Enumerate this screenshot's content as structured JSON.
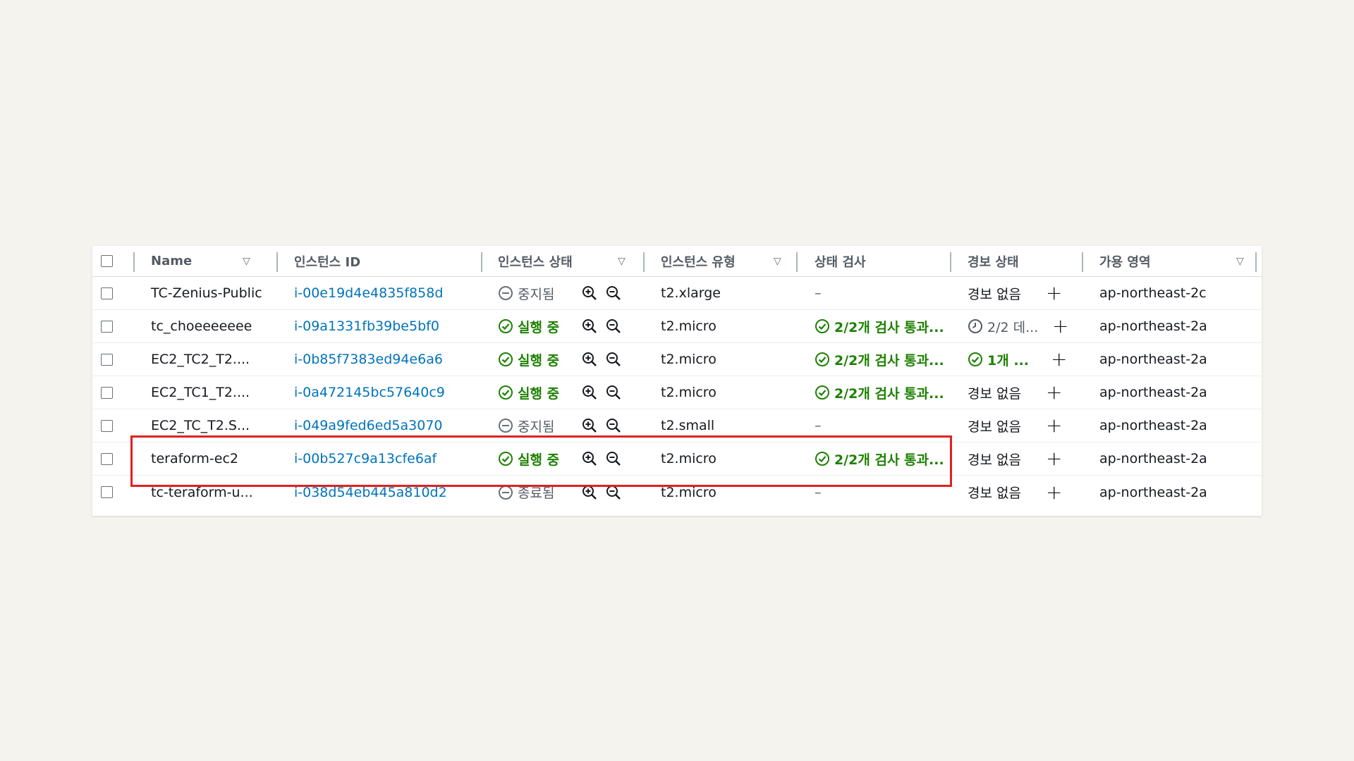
{
  "table": {
    "headers": {
      "name": "Name",
      "instance_id": "인스턴스 ID",
      "instance_state": "인스턴스 상태",
      "instance_type": "인스턴스 유형",
      "status_check": "상태 검사",
      "alarm_status": "경보 상태",
      "availability_zone": "가용 영역"
    },
    "rows": [
      {
        "name": "TC-Zenius-Public",
        "instance_id": "i-00e19d4e4835f858d",
        "state": "중지됨",
        "type": "t2.xlarge",
        "status_check": "–",
        "alarm": "경보 없음",
        "az": "ap-northeast-2c"
      },
      {
        "name": "tc_choeeeeeee",
        "instance_id": "i-09a1331fb39be5bf0",
        "state": "실행 중",
        "type": "t2.micro",
        "status_check": "2/2개 검사 통과...",
        "alarm": "2/2 데...",
        "az": "ap-northeast-2a"
      },
      {
        "name": "EC2_TC2_T2....",
        "instance_id": "i-0b85f7383ed94e6a6",
        "state": "실행 중",
        "type": "t2.micro",
        "status_check": "2/2개 검사 통과...",
        "alarm": "1개 ...",
        "az": "ap-northeast-2a"
      },
      {
        "name": "EC2_TC1_T2....",
        "instance_id": "i-0a472145bc57640c9",
        "state": "실행 중",
        "type": "t2.micro",
        "status_check": "2/2개 검사 통과...",
        "alarm": "경보 없음",
        "az": "ap-northeast-2a"
      },
      {
        "name": "EC2_TC_T2.S...",
        "instance_id": "i-049a9fed6ed5a3070",
        "state": "중지됨",
        "type": "t2.small",
        "status_check": "–",
        "alarm": "경보 없음",
        "az": "ap-northeast-2a"
      },
      {
        "name": "teraform-ec2",
        "instance_id": "i-00b527c9a13cfe6af",
        "state": "실행 중",
        "type": "t2.micro",
        "status_check": "2/2개 검사 통과...",
        "alarm": "경보 없음",
        "az": "ap-northeast-2a"
      },
      {
        "name": "tc-teraform-u...",
        "instance_id": "i-038d54eb445a810d2",
        "state": "종료됨",
        "type": "t2.micro",
        "status_check": "–",
        "alarm": "경보 없음",
        "az": "ap-northeast-2a"
      }
    ]
  },
  "colors": {
    "link": "#0073bb",
    "running": "#1d8102",
    "highlight": "#e02020"
  }
}
